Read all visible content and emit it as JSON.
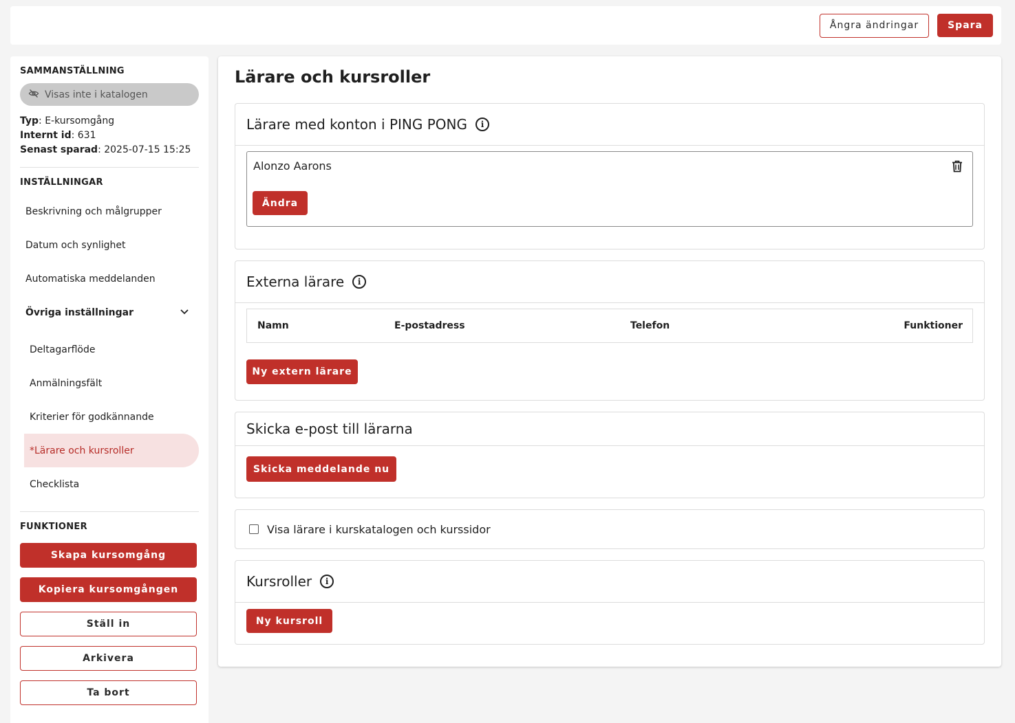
{
  "topbar": {
    "undo_label": "Ångra ändringar",
    "save_label": "Spara"
  },
  "sidebar": {
    "summary_title": "SAMMANSTÄLLNING",
    "visibility_pill": "Visas inte i katalogen",
    "meta": {
      "type_label": "Typ",
      "type_value": ": E-kursomgång",
      "id_label": "Internt id",
      "id_value": ": 631",
      "saved_label": "Senast sparad",
      "saved_value": ": 2025-07-15 15:25"
    },
    "settings_title": "INSTÄLLNINGAR",
    "settings_items": [
      "Beskrivning och målgrupper",
      "Datum och synlighet",
      "Automatiska meddelanden"
    ],
    "other_settings_label": "Övriga inställningar",
    "other_settings_items": [
      "Deltagarflöde",
      "Anmälningsfält",
      "Kriterier för godkännande",
      "*Lärare och kursroller",
      "Checklista"
    ],
    "functions_title": "FUNKTIONER",
    "functions": {
      "create": "Skapa kursomgång",
      "copy": "Kopiera kursomgången",
      "cancel": "Ställ in",
      "archive": "Arkivera",
      "delete": "Ta bort"
    }
  },
  "main": {
    "title": "Lärare och kursroller",
    "teachers_card": {
      "title": "Lärare med konton i PING PONG",
      "teacher_name": "Alonzo Aarons",
      "change_label": "Ändra"
    },
    "external_card": {
      "title": "Externa lärare",
      "columns": [
        "Namn",
        "E-postadress",
        "Telefon",
        "Funktioner"
      ],
      "new_label": "Ny extern lärare"
    },
    "email_card": {
      "title": "Skicka e-post till lärarna",
      "send_label": "Skicka meddelande nu"
    },
    "show_teachers_label": "Visa lärare i kurskatalogen och kurssidor",
    "roles_card": {
      "title": "Kursroller",
      "new_label": "Ny kursroll"
    }
  },
  "colors": {
    "accent": "#c0302a",
    "active_bg": "#f7e1e1",
    "page_bg": "#f4f4f4"
  }
}
